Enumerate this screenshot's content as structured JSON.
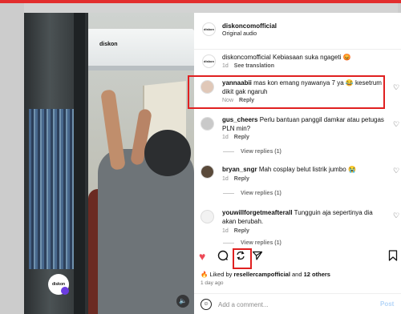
{
  "video": {
    "logo_text": "diskon",
    "badge_text": "diskon"
  },
  "header": {
    "username": "diskoncomofficial",
    "subtitle": "Original audio",
    "avatar_text": "diskon"
  },
  "comments": [
    {
      "avatar_text": "diskon",
      "username": "",
      "text": "diskoncomofficial Kebiasaan suka ngageti 😡",
      "time": "1d",
      "action": "See translation"
    },
    {
      "username": "yannaabii",
      "text": "mas kon emang nyawanya 7 ya 😂 kesetrum dikit gak ngaruh",
      "time": "Now",
      "action": "Reply"
    },
    {
      "username": "gus_cheers",
      "text": "Perlu bantuan panggil damkar atau petugas PLN min?",
      "time": "1d",
      "action": "Reply",
      "replies": "View replies (1)"
    },
    {
      "username": "bryan_sngr",
      "text": "Mah cosplay belut listrik jumbo 😭",
      "time": "1d",
      "action": "Reply",
      "replies": "View replies (1)"
    },
    {
      "username": "youwillforgetmeafterall",
      "text": "Tungguin aja sepertinya dia akan berubah.",
      "time": "1d",
      "action": "Reply",
      "replies": "View replies (1)"
    }
  ],
  "likes": {
    "prefix": "Liked by",
    "user": "resellercampofficial",
    "and": "and",
    "others": "12 others"
  },
  "post_age": "1 day ago",
  "add_comment": {
    "placeholder": "Add a comment...",
    "post_label": "Post"
  },
  "icons": {
    "heart": "heart-icon",
    "comment": "comment-icon",
    "repost": "repost-icon",
    "share": "share-icon",
    "save": "bookmark-icon"
  },
  "colors": {
    "like": "#ed4956",
    "highlight": "#e02020"
  }
}
